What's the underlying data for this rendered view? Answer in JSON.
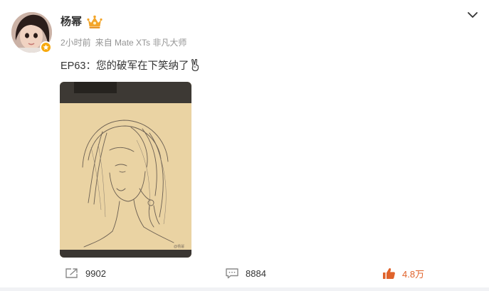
{
  "colors": {
    "accent_orange": "#e0632b",
    "verify_badge": "#f7a90e",
    "meta_gray": "#939393",
    "text": "#333333"
  },
  "post": {
    "author": {
      "name": "杨幂",
      "vip_icon": "vip-crown-icon",
      "verified_icon": "verified-badge-icon"
    },
    "meta": {
      "time": "2小时前",
      "source": "来自 Mate XTs 非凡大师"
    },
    "text": "EP63：您的破军在下笑纳了",
    "emoji_icon": "victory-hand-icon",
    "image": {
      "description_icon": "sketch-drawing-image"
    }
  },
  "actions": {
    "repost": {
      "icon": "repost-icon",
      "count": "9902"
    },
    "comment": {
      "icon": "comment-icon",
      "count": "8884"
    },
    "like": {
      "icon": "thumbs-up-icon",
      "count": "4.8万"
    }
  },
  "more_icon": "chevron-down-icon"
}
